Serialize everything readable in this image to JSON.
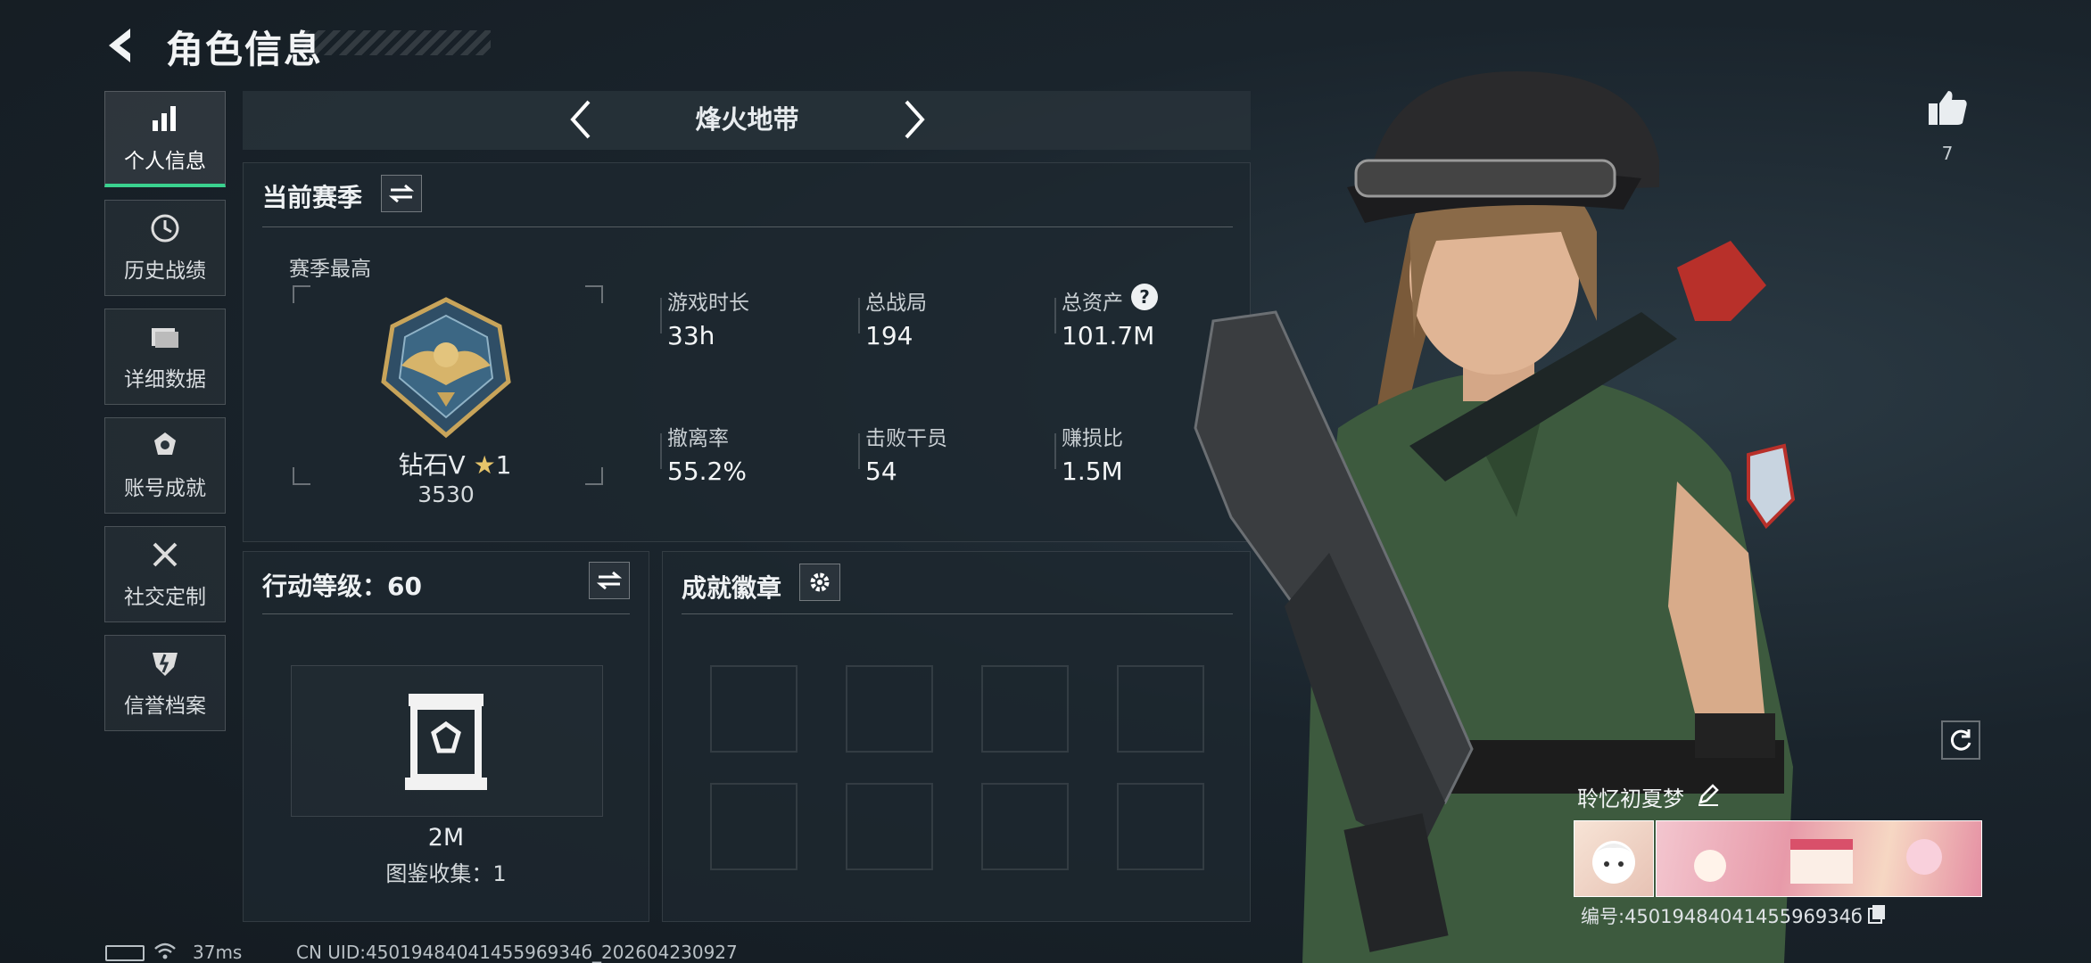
{
  "header": {
    "title": "角色信息"
  },
  "nav": {
    "items": [
      {
        "label": "个人信息",
        "icon": "bar-chart-icon",
        "active": true
      },
      {
        "label": "历史战绩",
        "icon": "history-icon"
      },
      {
        "label": "详细数据",
        "icon": "folder-icon"
      },
      {
        "label": "账号成就",
        "icon": "achievement-icon"
      },
      {
        "label": "社交定制",
        "icon": "tools-icon"
      },
      {
        "label": "信誉档案",
        "icon": "credit-shield-icon"
      }
    ]
  },
  "mode": {
    "name": "烽火地带"
  },
  "current_season": {
    "title": "当前赛季",
    "highest_label": "赛季最高",
    "rank_name": "钻石V",
    "rank_stars": "1",
    "rank_points": "3530",
    "stats": [
      {
        "label": "游戏时长",
        "value": "33h"
      },
      {
        "label": "总战局",
        "value": "194"
      },
      {
        "label": "总资产",
        "value": "101.7M",
        "has_help": true
      },
      {
        "label": "撤离率",
        "value": "55.2%"
      },
      {
        "label": "击败干员",
        "value": "54"
      },
      {
        "label": "赚损比",
        "value": "1.5M"
      }
    ],
    "help_glyph": "?"
  },
  "action_level": {
    "title": "行动等级：60",
    "collection_value": "2M",
    "collection_label": "图鉴收集：1"
  },
  "achievement_badges": {
    "title": "成就徽章",
    "slots": 8
  },
  "profile": {
    "likes": "7",
    "nickname": "聆忆初夏梦",
    "id_label": "编号:4501948404145596934б"
  },
  "status_bar": {
    "ping": "37ms",
    "uid": "CN UID:4501948404145596934б_202604230927"
  },
  "colors": {
    "accent": "#3ad28f",
    "bg": "#1a242c"
  }
}
